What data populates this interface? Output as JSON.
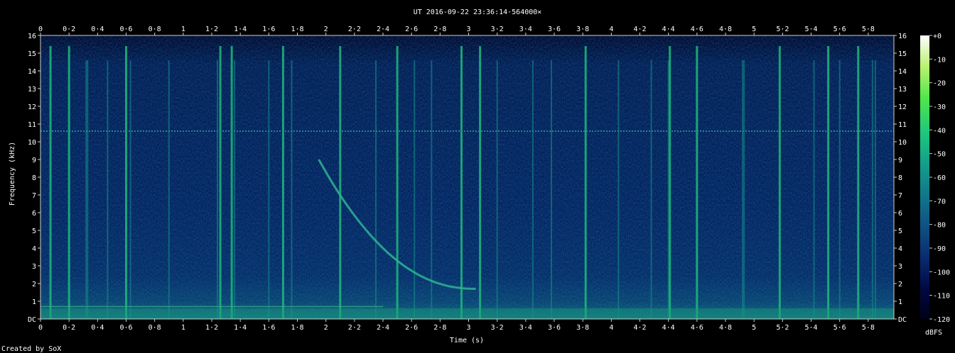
{
  "chart_data": {
    "type": "heatmap",
    "title": "UT 2016-09-22 23:36:14·564000×",
    "xlabel": "Time (s)",
    "ylabel": "Frequency (kHz)",
    "xlim": [
      0,
      5.98
    ],
    "ylim": [
      0,
      16
    ],
    "x_ticks": [
      "0",
      "0·2",
      "0·4",
      "0·6",
      "0·8",
      "1",
      "1·2",
      "1·4",
      "1·6",
      "1·8",
      "2",
      "2·2",
      "2·4",
      "2·6",
      "2·8",
      "3",
      "3·2",
      "3·4",
      "3·6",
      "3·8",
      "4",
      "4·2",
      "4·4",
      "4·6",
      "4·8",
      "5",
      "5·2",
      "5·4",
      "5·6",
      "5·8"
    ],
    "x_tick_values": [
      0,
      0.2,
      0.4,
      0.6,
      0.8,
      1,
      1.2,
      1.4,
      1.6,
      1.8,
      2,
      2.2,
      2.4,
      2.6,
      2.8,
      3,
      3.2,
      3.4,
      3.6,
      3.8,
      4,
      4.2,
      4.4,
      4.6,
      4.8,
      5,
      5.2,
      5.4,
      5.6,
      5.8
    ],
    "y_ticks": [
      "DC",
      "1",
      "2",
      "3",
      "4",
      "5",
      "6",
      "7",
      "8",
      "9",
      "10",
      "11",
      "12",
      "13",
      "14",
      "15",
      "16"
    ],
    "y_tick_values": [
      0,
      1,
      2,
      3,
      4,
      5,
      6,
      7,
      8,
      9,
      10,
      11,
      12,
      13,
      14,
      15,
      16
    ],
    "colorbar": {
      "label": "dBFS",
      "ticks": [
        "+0",
        "-10",
        "-20",
        "-30",
        "-40",
        "-50",
        "-60",
        "-70",
        "-80",
        "-90",
        "-100",
        "-110",
        "-120"
      ],
      "tick_values": [
        0,
        -10,
        -20,
        -30,
        -40,
        -50,
        -60,
        -70,
        -80,
        -90,
        -100,
        -110,
        -120
      ],
      "range": [
        -120,
        0
      ],
      "colormap": [
        "#000018",
        "#000a45",
        "#0a2c72",
        "#0f5383",
        "#10798a",
        "#13a08c",
        "#1ec87a",
        "#52e64c",
        "#b8f26e",
        "#ffffff"
      ]
    },
    "features": {
      "narrowband_tone_khz": 10.6,
      "low_band_hum_khz": 0.7,
      "whistler": {
        "start_s": 1.95,
        "start_khz": 9.0,
        "end_s": 3.05,
        "end_khz": 1.7
      },
      "sferic_times_s": [
        0.07,
        0.2,
        0.32,
        0.33,
        0.47,
        0.6,
        0.63,
        0.9,
        1.24,
        1.26,
        1.34,
        1.36,
        1.6,
        1.7,
        1.76,
        2.1,
        2.35,
        2.5,
        2.62,
        2.74,
        2.95,
        3.08,
        3.2,
        3.45,
        3.58,
        3.82,
        4.05,
        4.28,
        4.4,
        4.41,
        4.6,
        4.92,
        4.93,
        5.18,
        5.42,
        5.52,
        5.6,
        5.73,
        5.83,
        5.85
      ]
    },
    "footer": "Created by SoX"
  }
}
